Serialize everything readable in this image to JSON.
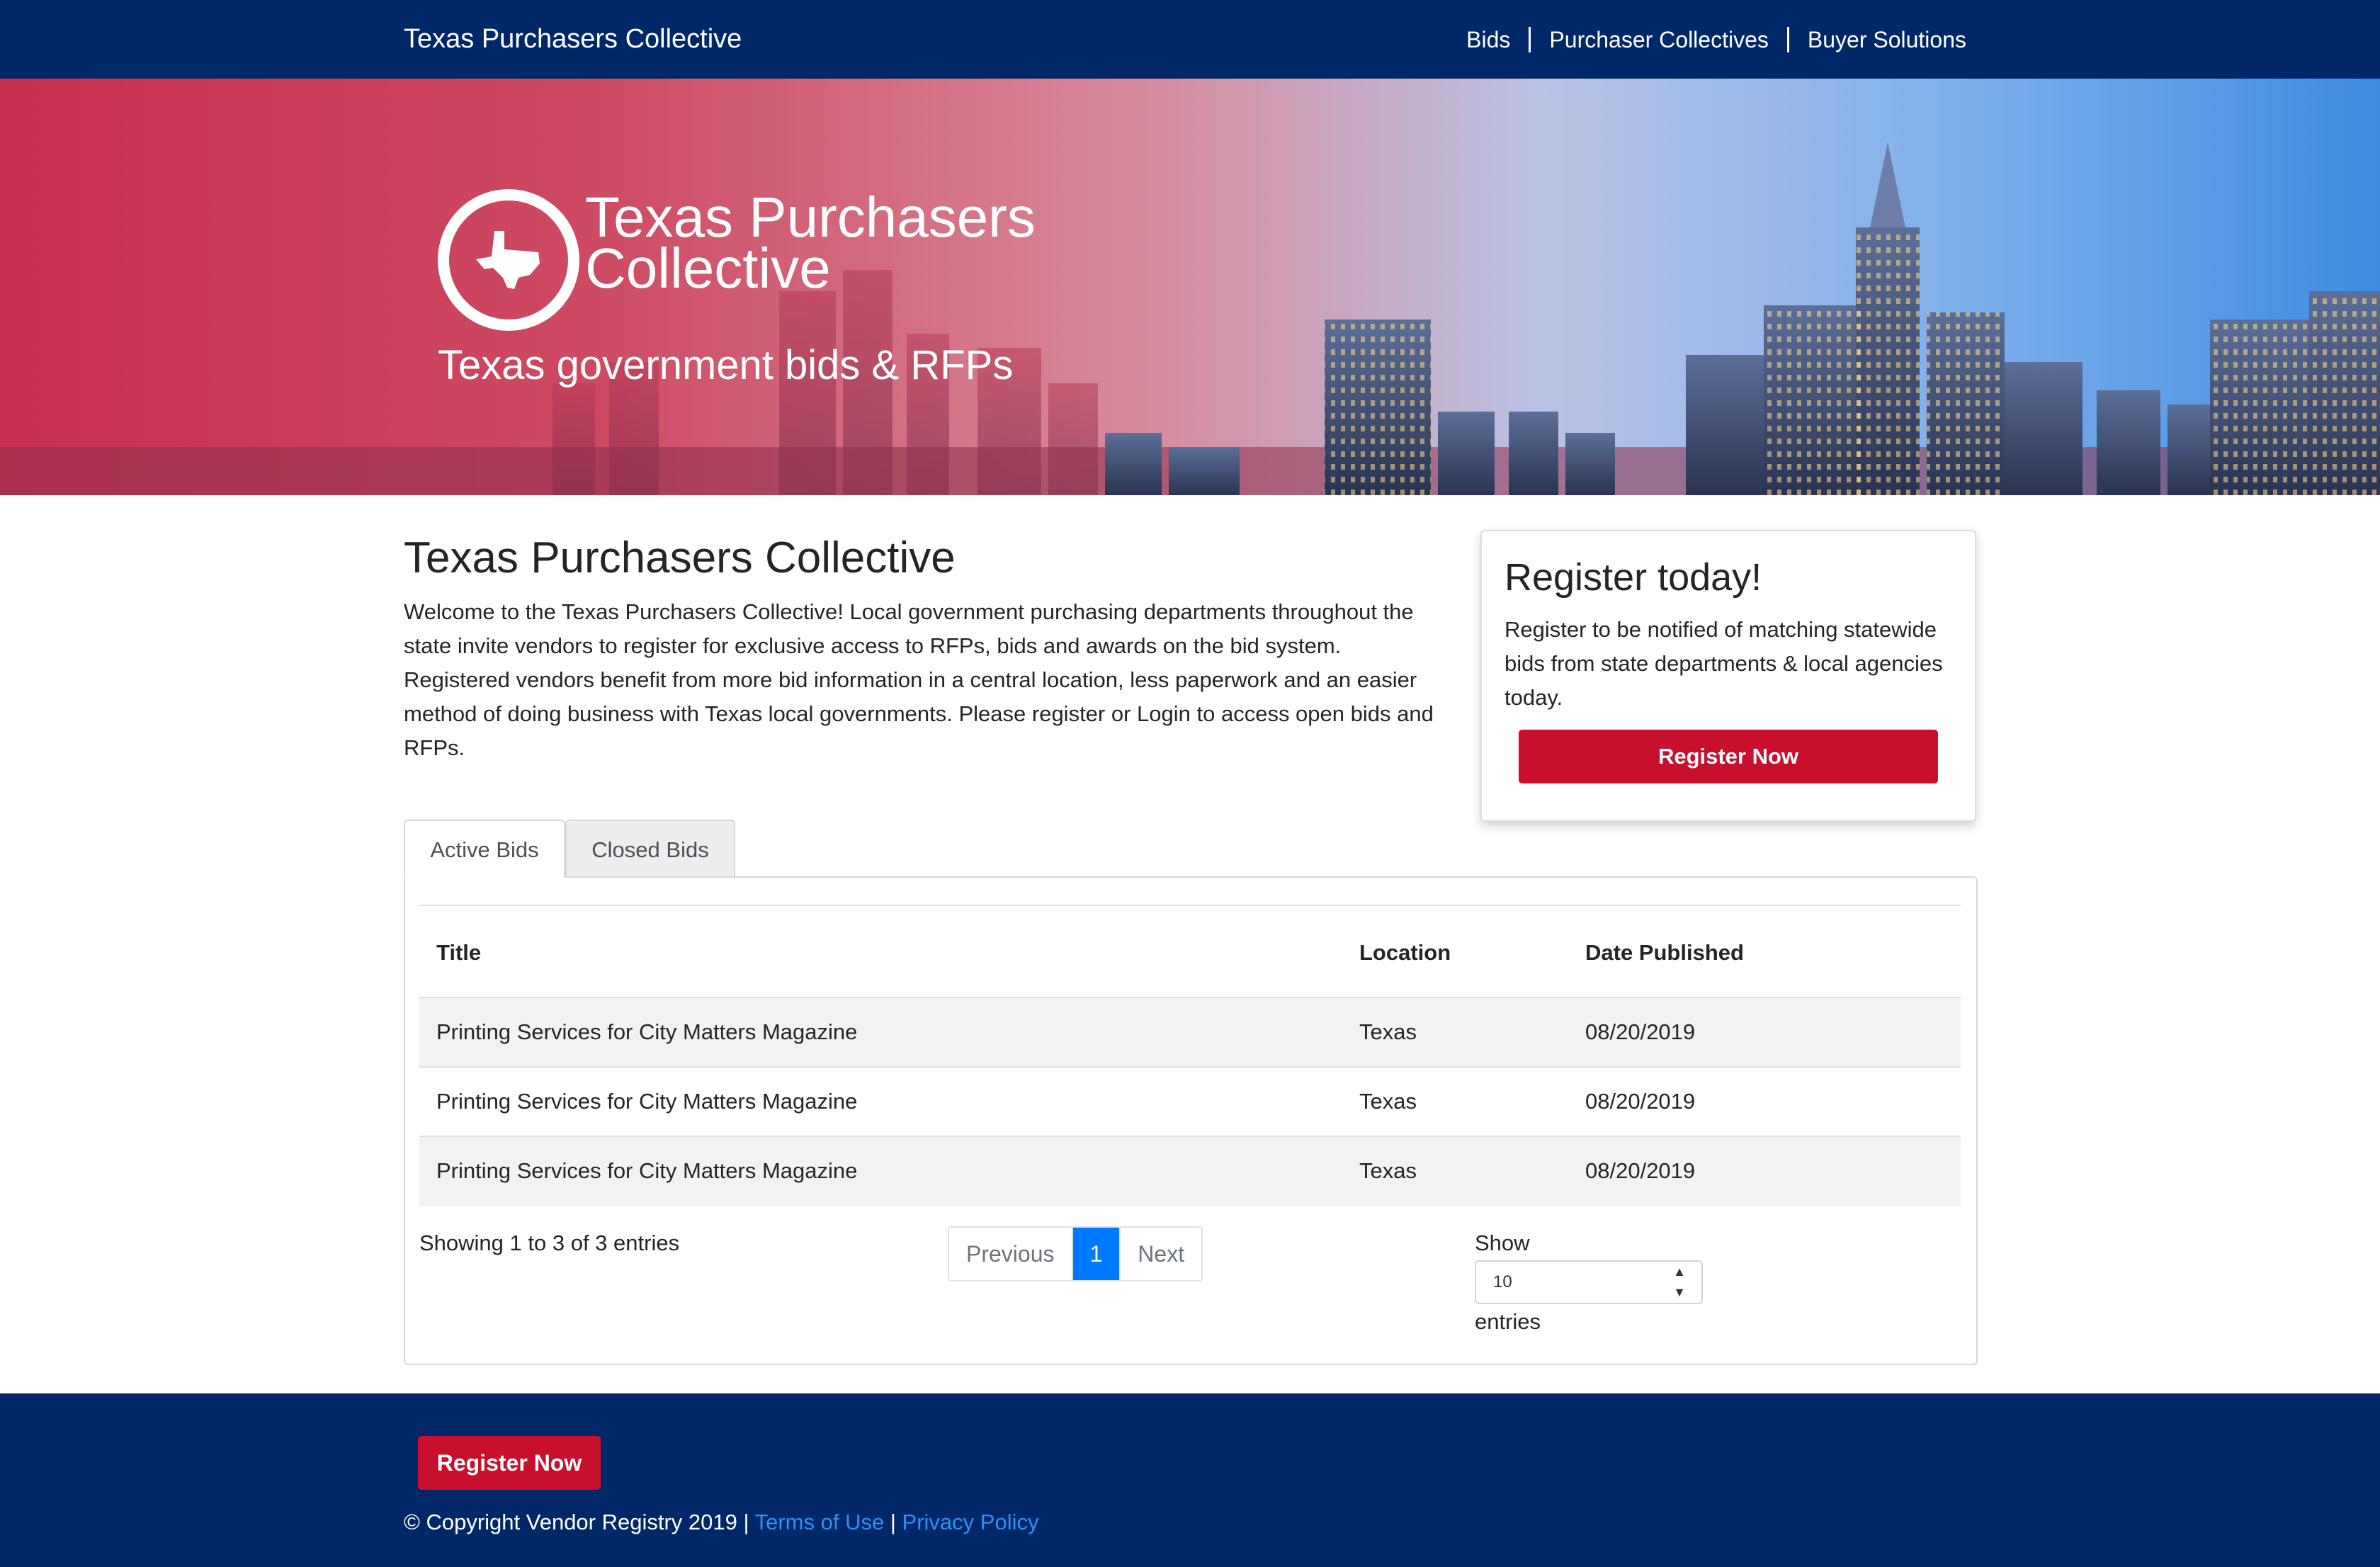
{
  "nav": {
    "brand": "Texas Purchasers Collective",
    "links": [
      "Bids",
      "Purchaser Collectives",
      "Buyer Solutions"
    ]
  },
  "hero": {
    "title_line1": "Texas Purchasers",
    "title_line2": "Collective",
    "subtitle": "Texas government bids & RFPs"
  },
  "main": {
    "title": "Texas Purchasers Collective",
    "intro": "Welcome to the Texas Purchasers Collective! Local government purchasing departments throughout the state invite vendors to register for exclusive access to RFPs, bids and awards on the bid system. Registered vendors benefit from more bid information in a central location, less paperwork and an easier method of doing business with Texas local governments. Please register or Login to access open bids and RFPs."
  },
  "register_card": {
    "title": "Register today!",
    "text": "Register to be notified of matching statewide bids from state departments & local agencies today.",
    "button": "Register Now"
  },
  "tabs": [
    "Active Bids",
    "Closed Bids"
  ],
  "table": {
    "headers": [
      "Title",
      "Location",
      "Date Published"
    ],
    "rows": [
      [
        "Printing Services for City Matters Magazine",
        "Texas",
        "08/20/2019"
      ],
      [
        "Printing Services for City Matters Magazine",
        "Texas",
        "08/20/2019"
      ],
      [
        "Printing Services for City Matters Magazine",
        "Texas",
        "08/20/2019"
      ]
    ]
  },
  "pagination": {
    "info": "Showing 1 to 3 of 3 entries",
    "previous": "Previous",
    "current": "1",
    "next": "Next",
    "show_label": "Show",
    "page_size": "10",
    "entries_label": "entries"
  },
  "footer": {
    "button": "Register Now",
    "copyright": "© Copyright Vendor Registry 2019 |",
    "terms": "Terms of Use",
    "divider": "|",
    "privacy": "Privacy Policy"
  },
  "colors": {
    "navy": "#002868",
    "red": "#c8102e",
    "link_blue": "#2e8ff7",
    "pager_active": "#007bff"
  }
}
